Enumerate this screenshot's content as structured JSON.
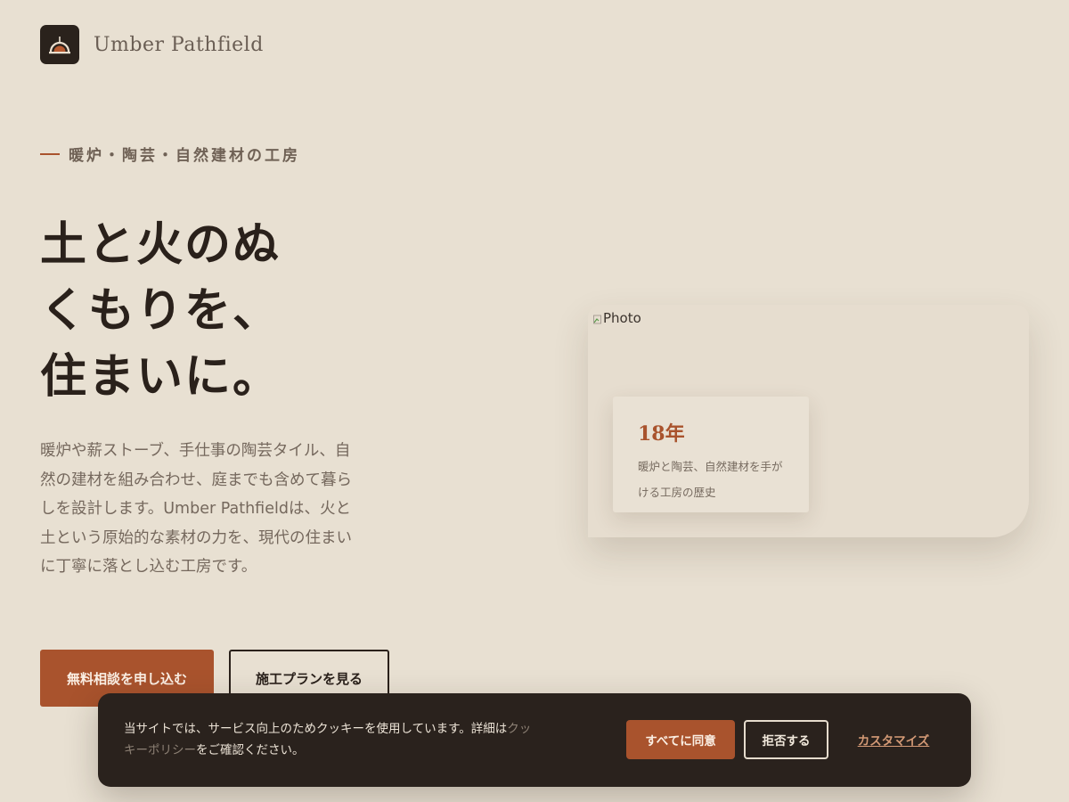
{
  "brand": {
    "name": "Umber Pathfield",
    "logo_icon": "arch-kiln-icon"
  },
  "hero": {
    "eyebrow": "暖炉・陶芸・自然建材の工房",
    "headline_lines": [
      "土と火のぬ",
      "くもりを、",
      "住まいに。"
    ],
    "lead": "暖炉や薪ストーブ、手仕事の陶芸タイル、自然の建材を組み合わせ、庭までも含めて暮らしを設計します。Umber Pathfieldは、火と土という原始的な素材の力を、現代の住まいに丁寧に落とし込む工房です。",
    "primary_button": "無料相談を申し込む",
    "secondary_button": "施工プランを見る"
  },
  "photo_card": {
    "image_alt": "Photo",
    "stat_value": "18年",
    "stat_desc": "暖炉と陶芸、自然建材を手がける工房の歴史"
  },
  "cookie_banner": {
    "text_before": "当サイトでは、サービス向上のためクッキーを使用しています。詳細は",
    "link_text": "クッキーポリシー",
    "text_after": "をご確認ください。",
    "accept_button": "すべてに同意",
    "reject_button": "拒否する",
    "customize_button": "カスタマイズ"
  },
  "colors": {
    "background": "#e8e0d2",
    "accent": "#a9532d",
    "dark": "#2a221c",
    "muted_text": "#75685d"
  }
}
